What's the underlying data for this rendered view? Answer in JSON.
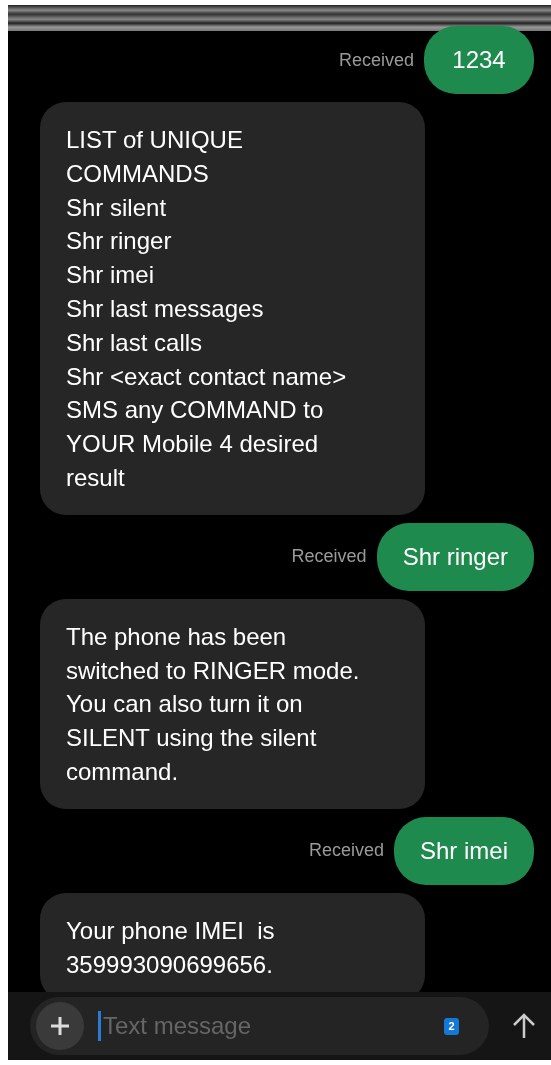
{
  "messages": [
    {
      "kind": "outgoing",
      "text": "1234",
      "status": "Received"
    },
    {
      "kind": "incoming",
      "lines": [
        "LIST of UNIQUE",
        "COMMANDS",
        "Shr silent",
        "Shr ringer",
        "Shr imei",
        "Shr last messages",
        "Shr last calls",
        "Shr <exact contact name>",
        "SMS any COMMAND to",
        "YOUR Mobile 4 desired",
        "result"
      ]
    },
    {
      "kind": "outgoing",
      "text": "Shr ringer",
      "status": "Received"
    },
    {
      "kind": "incoming",
      "lines": [
        "The phone has been",
        "switched to RINGER mode.",
        "You can also turn it on",
        "SILENT using the silent",
        "command."
      ]
    },
    {
      "kind": "outgoing",
      "text": "Shr imei",
      "status": "Received"
    },
    {
      "kind": "incoming",
      "lines": [
        "Your phone IMEI  is",
        "359993090699656."
      ]
    }
  ],
  "composer": {
    "placeholder": "Text message",
    "sim_badge": "2"
  }
}
